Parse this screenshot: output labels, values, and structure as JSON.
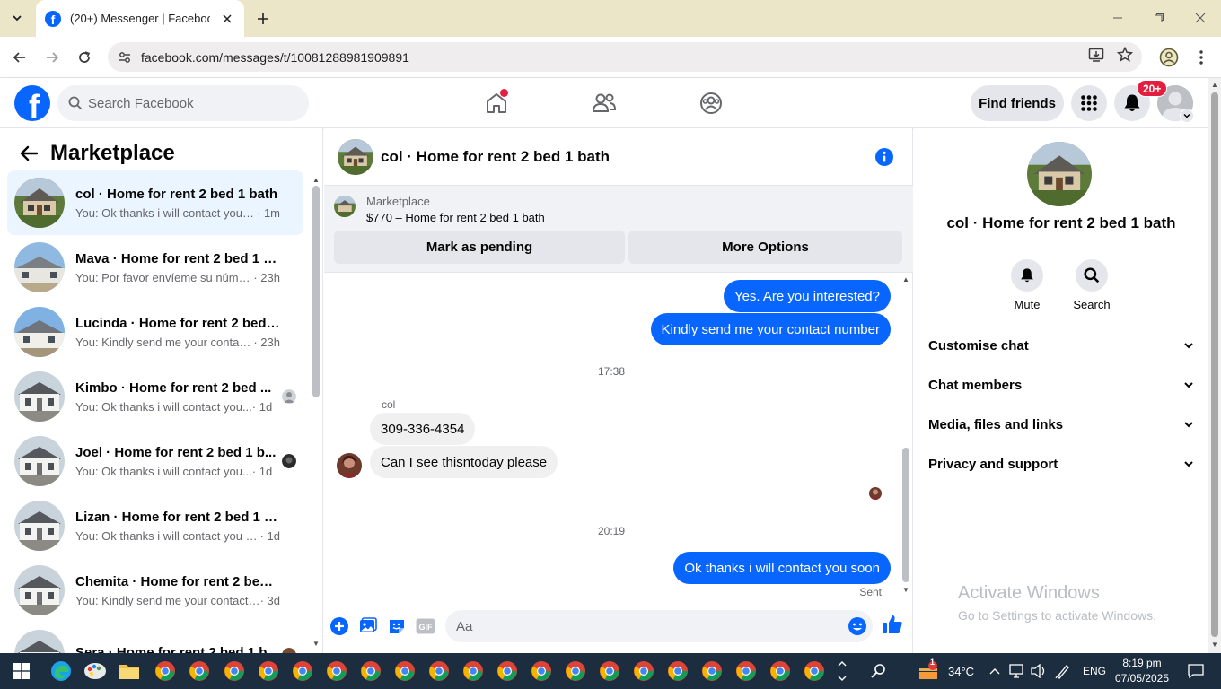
{
  "browser": {
    "tab_title": "(20+) Messenger | Facebook",
    "url": "facebook.com/messages/t/10081288981909891"
  },
  "header": {
    "logo_letter": "f",
    "search_placeholder": "Search Facebook",
    "find_friends": "Find friends",
    "notif_badge": "20+"
  },
  "sidebar": {
    "title": "Marketplace",
    "conversations": [
      {
        "name": "col · Home for rent 2 bed 1 bath",
        "snippet": "You: Ok thanks i will contact you s...",
        "time": " · 1m"
      },
      {
        "name": "Mava · Home for rent 2 bed 1 ba...",
        "snippet": "You: Por favor envíeme su número...",
        "time": " · 23h"
      },
      {
        "name": "Lucinda · Home for rent 2 bed 1 ...",
        "snippet": "You: Kindly send me your contact ...",
        "time": " · 23h"
      },
      {
        "name": "Kimbo · Home for rent 2 bed ...",
        "snippet": "You: Ok thanks i will contact you...",
        "time": " · 1d"
      },
      {
        "name": "Joel · Home for rent 2 bed 1 b...",
        "snippet": "You: Ok thanks i will contact you...",
        "time": " · 1d"
      },
      {
        "name": "Lizan · Home for rent 2 bed 1 bath",
        "snippet": "You: Ok thanks i will contact you so...",
        "time": " · 1d"
      },
      {
        "name": "Chemita · Home for rent 2 bed 1...",
        "snippet": "You: Kindly send me your contact n...",
        "time": " · 3d"
      },
      {
        "name": "Sera · Home for rent 2 bed 1 b...",
        "snippet": "",
        "time": ""
      }
    ]
  },
  "chat": {
    "title": "col · Home for rent 2 bed 1 bath",
    "marketplace_label": "Marketplace",
    "listing": "$770 – Home for rent 2 bed 1 bath",
    "mark_pending": "Mark as pending",
    "more_options": "More Options",
    "messages": {
      "out1": "Yes. Are you interested?",
      "out2": "Kindly send me your contact number",
      "ts1": "17:38",
      "sender": "col",
      "in1": "309-336-4354",
      "in2": "Can I see thisntoday please",
      "ts2": "20:19",
      "out3": "Ok thanks i will contact you soon",
      "status": "Sent"
    },
    "composer_placeholder": "Aa"
  },
  "info_panel": {
    "name": "col · Home for rent 2 bed 1 bath",
    "mute": "Mute",
    "search": "Search",
    "sections": [
      "Customise chat",
      "Chat members",
      "Media, files and links",
      "Privacy and support"
    ]
  },
  "watermark": {
    "title": "Activate Windows",
    "subtitle": "Go to Settings to activate Windows."
  },
  "taskbar": {
    "temperature": "34°C",
    "weather_badge": "1",
    "language": "ENG",
    "time": "8:19 pm",
    "date": "07/05/2025"
  },
  "colors": {
    "accent": "#0866ff",
    "badge": "#e41e3f",
    "taskbar": "#1c2d3f"
  }
}
